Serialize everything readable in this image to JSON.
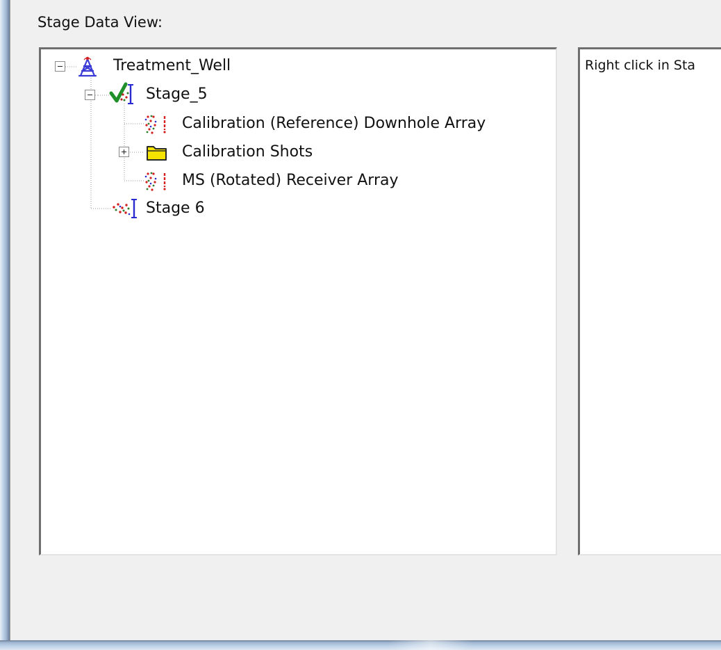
{
  "group": {
    "label": "Stage Data View:"
  },
  "tree": {
    "root": {
      "label": "Treatment_Well",
      "icon": "well-tower-icon",
      "expanded": true
    },
    "stage5": {
      "label": "Stage_5",
      "icon": "stage-checked-icon",
      "expanded": true,
      "children": [
        {
          "label": "Calibration (Reference) Downhole Array",
          "icon": "receiver-array-icon"
        },
        {
          "label": "Calibration Shots",
          "icon": "folder-icon",
          "expanded": false
        },
        {
          "label": "MS (Rotated) Receiver Array",
          "icon": "receiver-array-icon"
        }
      ]
    },
    "stage6": {
      "label": "Stage 6",
      "icon": "stage-icon"
    }
  },
  "info_panel": {
    "text": "Right click in Sta"
  },
  "colors": {
    "window_frame": "#9fb6d1",
    "panel_background": "#f0f0f0",
    "folder_fill": "#f5e400",
    "check_green": "#1f8f2a",
    "tower_blue": "#3a3ad6"
  }
}
